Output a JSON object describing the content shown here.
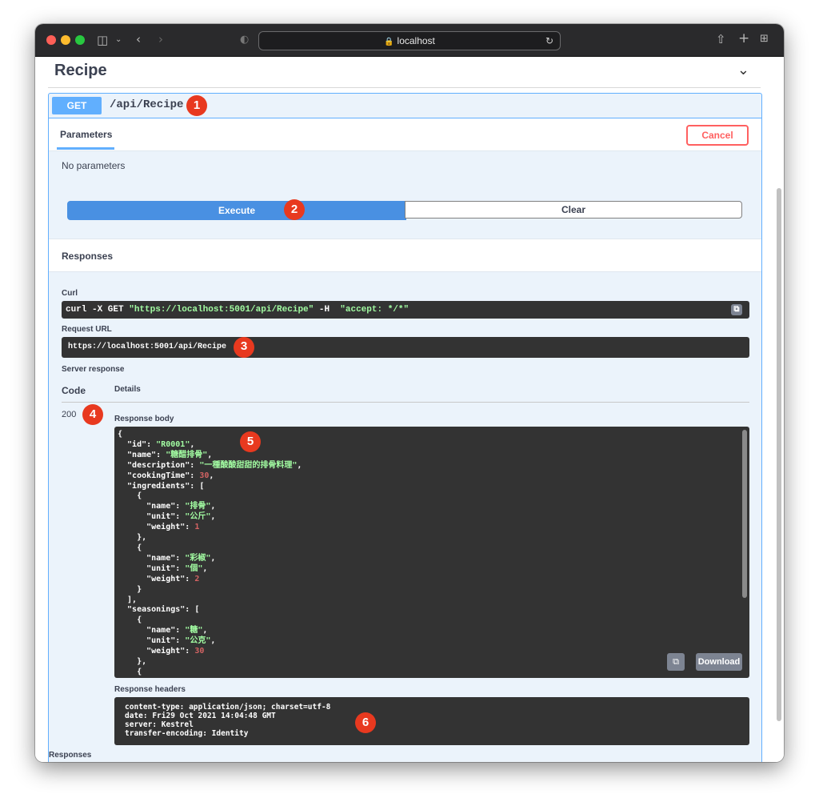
{
  "browser": {
    "address": "localhost",
    "lock_icon": "lock-icon"
  },
  "section": {
    "title": "Recipe"
  },
  "operation": {
    "method": "GET",
    "path": "/api/Recipe",
    "tab_parameters": "Parameters",
    "cancel_label": "Cancel",
    "no_parameters": "No parameters",
    "execute_label": "Execute",
    "clear_label": "Clear",
    "responses_label": "Responses"
  },
  "result": {
    "curl_label": "Curl",
    "curl_prefix": "curl -X GET ",
    "curl_url": "\"https://localhost:5001/api/Recipe\"",
    "curl_mid": " -H  ",
    "curl_header": "\"accept: */*\"",
    "request_url_label": "Request URL",
    "request_url": "https://localhost:5001/api/Recipe",
    "server_response_label": "Server response",
    "code_header": "Code",
    "details_header": "Details",
    "code": "200",
    "response_body_label": "Response body",
    "download_label": "Download",
    "response_headers_label": "Response headers",
    "response_headers": [
      "content-type: application/json; charset=utf-8",
      "date: Fri29 Oct 2021 14:04:48 GMT",
      "server: Kestrel",
      "transfer-encoding: Identity"
    ],
    "bottom_responses_label": "Responses"
  },
  "response_body": {
    "id": "R0001",
    "name": "糖醋排骨",
    "description": "一種酸酸甜甜的排骨料理",
    "cookingTime": 30,
    "ingredients": [
      {
        "name": "排骨",
        "unit": "公斤",
        "weight": 1
      },
      {
        "name": "彩椒",
        "unit": "個",
        "weight": 2
      }
    ],
    "seasonings": [
      {
        "name": "糖",
        "unit": "公克",
        "weight": 30
      }
    ]
  },
  "annotations": [
    "1",
    "2",
    "3",
    "4",
    "5",
    "6"
  ]
}
